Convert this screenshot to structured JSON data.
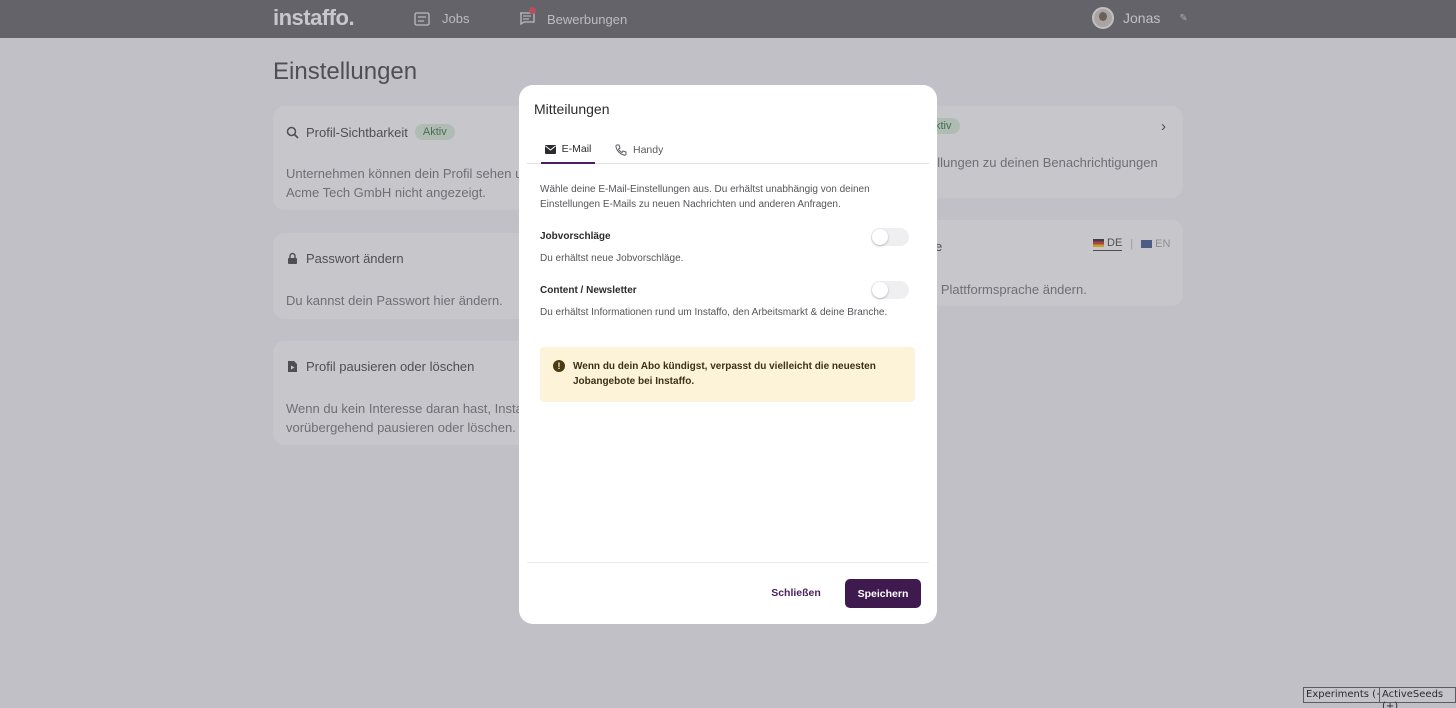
{
  "nav": {
    "logo": "instaffo.",
    "jobs_label": "Jobs",
    "applications_label": "Bewerbungen",
    "user_name": "Jonas"
  },
  "page": {
    "title": "Einstellungen",
    "cards": {
      "visibility": {
        "title": "Profil-Sichtbarkeit",
        "badge": "Aktiv",
        "text": "Unternehmen können dein Profil sehen un",
        "text2": "Acme Tech GmbH nicht angezeigt."
      },
      "notifications": {
        "badge": "ktiv",
        "text": "ellungen zu deinen Benachrichtigungen"
      },
      "password": {
        "title": "Passwort ändern",
        "text": "Du kannst dein Passwort hier ändern."
      },
      "language": {
        "title_fragment": "e",
        "de": "DE",
        "en": "EN",
        "text": "e Plattformsprache ändern."
      },
      "pause": {
        "title": "Profil pausieren oder löschen",
        "text": "Wenn du kein Interesse daran hast, Instaff",
        "text2": "vorübergehend pausieren oder löschen."
      }
    }
  },
  "modal": {
    "title": "Mitteilungen",
    "tabs": [
      {
        "label": "E-Mail",
        "active": true
      },
      {
        "label": "Handy",
        "active": false
      }
    ],
    "intro": "Wähle deine E-Mail-Einstellungen aus. Du erhältst unabhängig von deinen Einstellungen E-Mails zu neuen Nachrichten und anderen Anfragen.",
    "settings": [
      {
        "label": "Jobvorschläge",
        "desc": "Du erhältst neue Jobvorschläge.",
        "enabled": false
      },
      {
        "label": "Content / Newsletter",
        "desc": "Du erhältst Informationen rund um Instaffo, den Arbeitsmarkt & deine Branche.",
        "enabled": false
      }
    ],
    "warning": "Wenn du dein Abo kündigst, verpasst du vielleicht die neuesten Jobangebote bei Instaffo.",
    "close_label": "Schließen",
    "save_label": "Speichern"
  },
  "debug": {
    "experiments": "Experiments (+)",
    "active_seeds": "ActiveSeeds (+)"
  },
  "colors": {
    "accent": "#3e1a4f",
    "badge_bg": "#d7ecd9",
    "warning_bg": "#fdf3d8",
    "notification_dot": "#e23b4a"
  },
  "icons": {
    "jobs": "list-icon",
    "applications": "chat-icon",
    "visibility": "search-icon",
    "password": "lock-icon",
    "pause": "document-icon",
    "email_tab": "envelope-icon",
    "handy_tab": "phone-icon",
    "warning": "exclamation-icon",
    "edit": "pencil-icon"
  }
}
